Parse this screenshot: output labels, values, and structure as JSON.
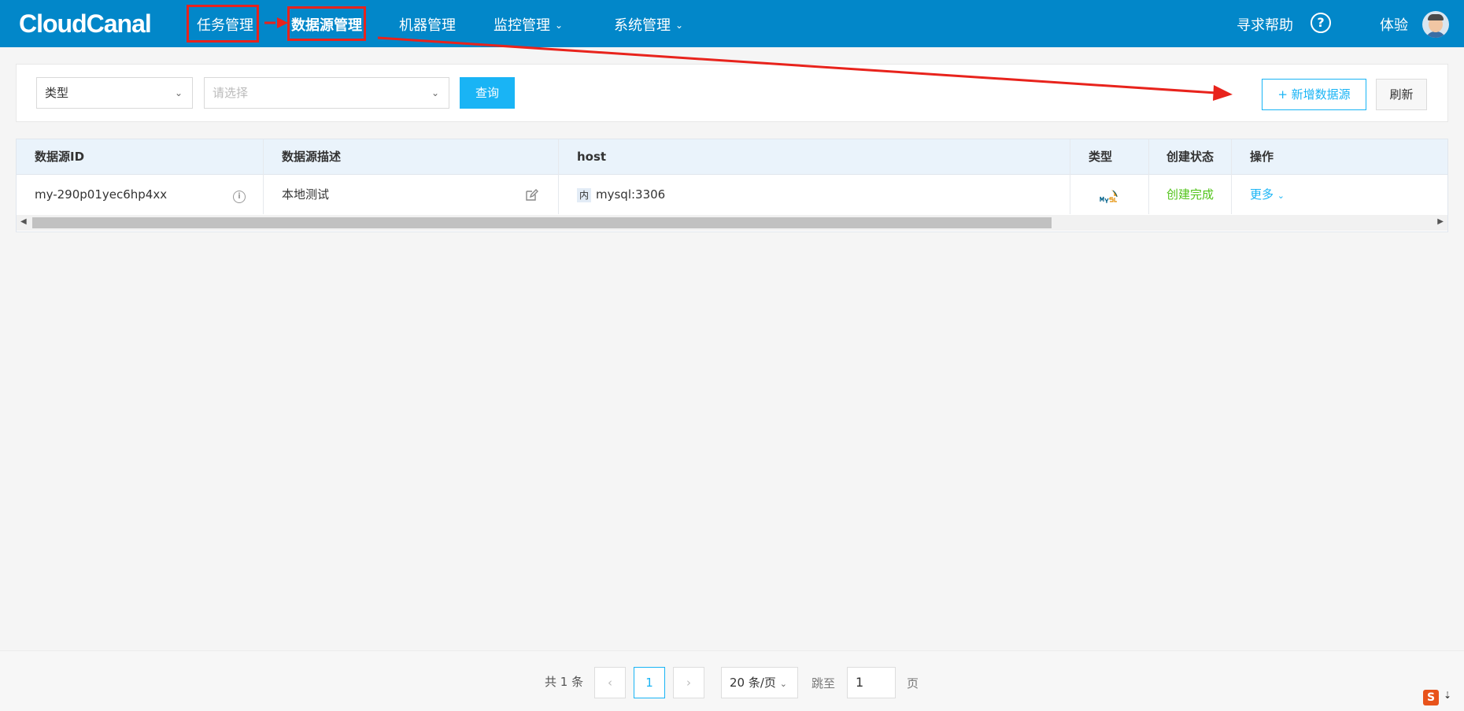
{
  "app": {
    "logo_text": "CloudCanal"
  },
  "nav": {
    "items": [
      {
        "label": "任务管理"
      },
      {
        "label": "数据源管理"
      },
      {
        "label": "机器管理"
      },
      {
        "label": "监控管理"
      },
      {
        "label": "系统管理"
      }
    ],
    "help_label": "寻求帮助",
    "help_icon": "question-circle-icon",
    "user_label": "体验"
  },
  "filters": {
    "type_select": {
      "value": "类型"
    },
    "choose_select": {
      "placeholder": "请选择"
    },
    "query_button": "查询"
  },
  "actions": {
    "add_button": "+ 新增数据源",
    "refresh_button": "刷新"
  },
  "table": {
    "headers": [
      "数据源ID",
      "数据源描述",
      "host",
      "类型",
      "创建状态",
      "操作"
    ],
    "rows": [
      {
        "id": "my-290p01yec6hp4xx",
        "desc": "本地测试",
        "host_tag": "内",
        "host": "mysql:3306",
        "type_icon": "mysql-logo",
        "status": "创建完成",
        "action": "更多"
      }
    ]
  },
  "pagination": {
    "total": "共 1 条",
    "current_page": "1",
    "page_size": "20 条/页",
    "jump_label": "跳至",
    "jump_value": "1",
    "page_unit": "页"
  },
  "colors": {
    "topbar": "#0287c9",
    "accent": "#19b4f5",
    "highlight": "#e8231c",
    "success": "#52c41a"
  }
}
